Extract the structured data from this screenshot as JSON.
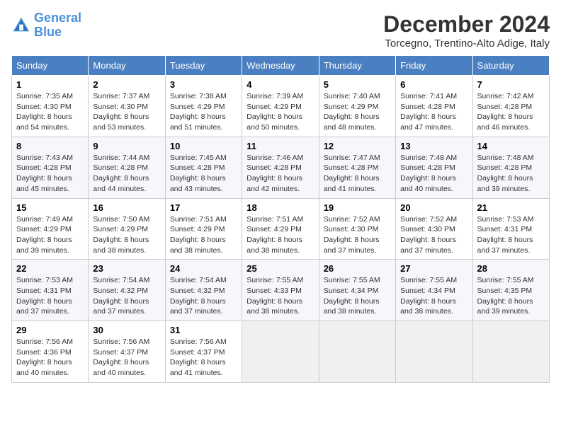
{
  "header": {
    "logo_line1": "General",
    "logo_line2": "Blue",
    "month_year": "December 2024",
    "location": "Torcegno, Trentino-Alto Adige, Italy"
  },
  "weekdays": [
    "Sunday",
    "Monday",
    "Tuesday",
    "Wednesday",
    "Thursday",
    "Friday",
    "Saturday"
  ],
  "weeks": [
    [
      {
        "day": "1",
        "sunrise": "7:35 AM",
        "sunset": "4:30 PM",
        "daylight": "8 hours and 54 minutes."
      },
      {
        "day": "2",
        "sunrise": "7:37 AM",
        "sunset": "4:30 PM",
        "daylight": "8 hours and 53 minutes."
      },
      {
        "day": "3",
        "sunrise": "7:38 AM",
        "sunset": "4:29 PM",
        "daylight": "8 hours and 51 minutes."
      },
      {
        "day": "4",
        "sunrise": "7:39 AM",
        "sunset": "4:29 PM",
        "daylight": "8 hours and 50 minutes."
      },
      {
        "day": "5",
        "sunrise": "7:40 AM",
        "sunset": "4:29 PM",
        "daylight": "8 hours and 48 minutes."
      },
      {
        "day": "6",
        "sunrise": "7:41 AM",
        "sunset": "4:28 PM",
        "daylight": "8 hours and 47 minutes."
      },
      {
        "day": "7",
        "sunrise": "7:42 AM",
        "sunset": "4:28 PM",
        "daylight": "8 hours and 46 minutes."
      }
    ],
    [
      {
        "day": "8",
        "sunrise": "7:43 AM",
        "sunset": "4:28 PM",
        "daylight": "8 hours and 45 minutes."
      },
      {
        "day": "9",
        "sunrise": "7:44 AM",
        "sunset": "4:28 PM",
        "daylight": "8 hours and 44 minutes."
      },
      {
        "day": "10",
        "sunrise": "7:45 AM",
        "sunset": "4:28 PM",
        "daylight": "8 hours and 43 minutes."
      },
      {
        "day": "11",
        "sunrise": "7:46 AM",
        "sunset": "4:28 PM",
        "daylight": "8 hours and 42 minutes."
      },
      {
        "day": "12",
        "sunrise": "7:47 AM",
        "sunset": "4:28 PM",
        "daylight": "8 hours and 41 minutes."
      },
      {
        "day": "13",
        "sunrise": "7:48 AM",
        "sunset": "4:28 PM",
        "daylight": "8 hours and 40 minutes."
      },
      {
        "day": "14",
        "sunrise": "7:48 AM",
        "sunset": "4:28 PM",
        "daylight": "8 hours and 39 minutes."
      }
    ],
    [
      {
        "day": "15",
        "sunrise": "7:49 AM",
        "sunset": "4:29 PM",
        "daylight": "8 hours and 39 minutes."
      },
      {
        "day": "16",
        "sunrise": "7:50 AM",
        "sunset": "4:29 PM",
        "daylight": "8 hours and 38 minutes."
      },
      {
        "day": "17",
        "sunrise": "7:51 AM",
        "sunset": "4:29 PM",
        "daylight": "8 hours and 38 minutes."
      },
      {
        "day": "18",
        "sunrise": "7:51 AM",
        "sunset": "4:29 PM",
        "daylight": "8 hours and 38 minutes."
      },
      {
        "day": "19",
        "sunrise": "7:52 AM",
        "sunset": "4:30 PM",
        "daylight": "8 hours and 37 minutes."
      },
      {
        "day": "20",
        "sunrise": "7:52 AM",
        "sunset": "4:30 PM",
        "daylight": "8 hours and 37 minutes."
      },
      {
        "day": "21",
        "sunrise": "7:53 AM",
        "sunset": "4:31 PM",
        "daylight": "8 hours and 37 minutes."
      }
    ],
    [
      {
        "day": "22",
        "sunrise": "7:53 AM",
        "sunset": "4:31 PM",
        "daylight": "8 hours and 37 minutes."
      },
      {
        "day": "23",
        "sunrise": "7:54 AM",
        "sunset": "4:32 PM",
        "daylight": "8 hours and 37 minutes."
      },
      {
        "day": "24",
        "sunrise": "7:54 AM",
        "sunset": "4:32 PM",
        "daylight": "8 hours and 37 minutes."
      },
      {
        "day": "25",
        "sunrise": "7:55 AM",
        "sunset": "4:33 PM",
        "daylight": "8 hours and 38 minutes."
      },
      {
        "day": "26",
        "sunrise": "7:55 AM",
        "sunset": "4:34 PM",
        "daylight": "8 hours and 38 minutes."
      },
      {
        "day": "27",
        "sunrise": "7:55 AM",
        "sunset": "4:34 PM",
        "daylight": "8 hours and 38 minutes."
      },
      {
        "day": "28",
        "sunrise": "7:55 AM",
        "sunset": "4:35 PM",
        "daylight": "8 hours and 39 minutes."
      }
    ],
    [
      {
        "day": "29",
        "sunrise": "7:56 AM",
        "sunset": "4:36 PM",
        "daylight": "8 hours and 40 minutes."
      },
      {
        "day": "30",
        "sunrise": "7:56 AM",
        "sunset": "4:37 PM",
        "daylight": "8 hours and 40 minutes."
      },
      {
        "day": "31",
        "sunrise": "7:56 AM",
        "sunset": "4:37 PM",
        "daylight": "8 hours and 41 minutes."
      },
      null,
      null,
      null,
      null
    ]
  ],
  "labels": {
    "sunrise": "Sunrise:",
    "sunset": "Sunset:",
    "daylight": "Daylight:"
  }
}
